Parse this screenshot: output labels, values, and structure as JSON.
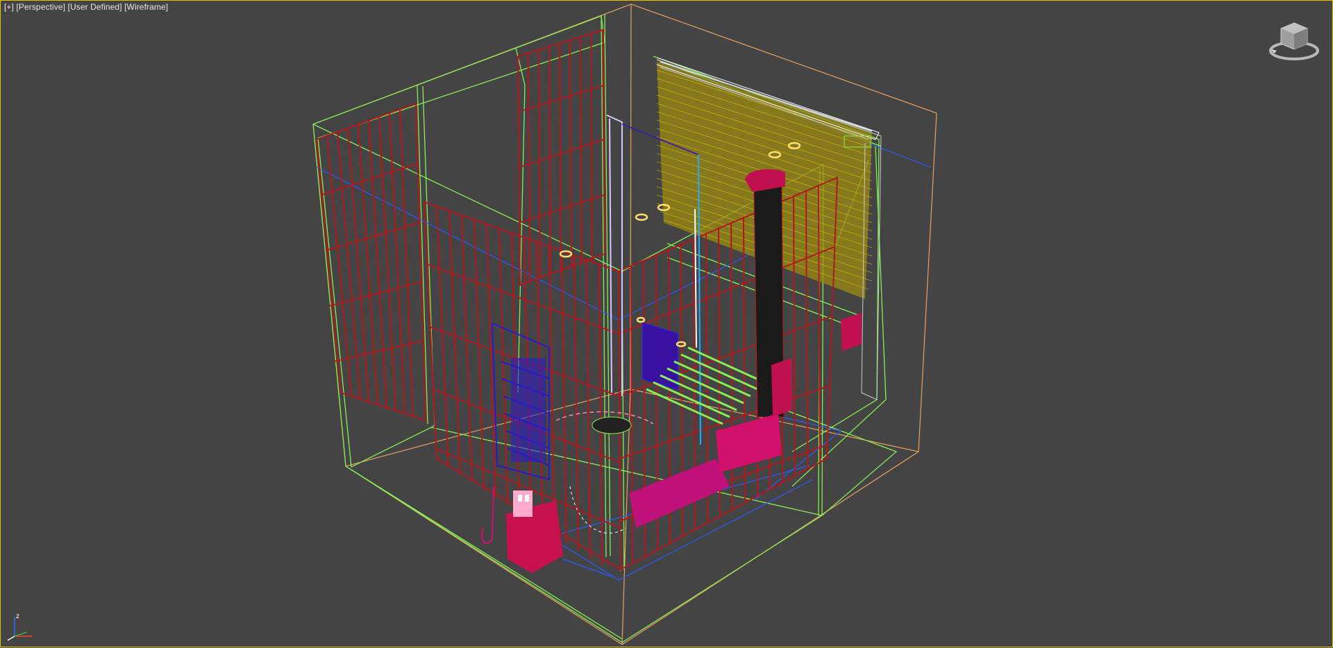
{
  "viewport": {
    "label_plus": "[+]",
    "label_view": "[Perspective]",
    "label_camera": "[User Defined]",
    "label_shading": "[Wireframe]",
    "active_border_color": "#e6c200",
    "background_color": "#444444"
  },
  "scene": {
    "description_icon": "wireframe-bathroom-scene",
    "colors": {
      "shower_glass": "#b0181e",
      "wall_boxes": "#88ee55",
      "room_bounds": "#e8a060",
      "blinds": "#c8a800",
      "towel_rack": "#2a1acc",
      "fixtures": "#d0106a",
      "water_pipe": "#22aaff",
      "rings": "#ffe070"
    }
  },
  "viewcube": {
    "icon": "viewcube-icon"
  },
  "axis_tripod": {
    "x_label": "",
    "y_label": "",
    "z_label": "z",
    "icon": "axis-tripod-icon"
  }
}
